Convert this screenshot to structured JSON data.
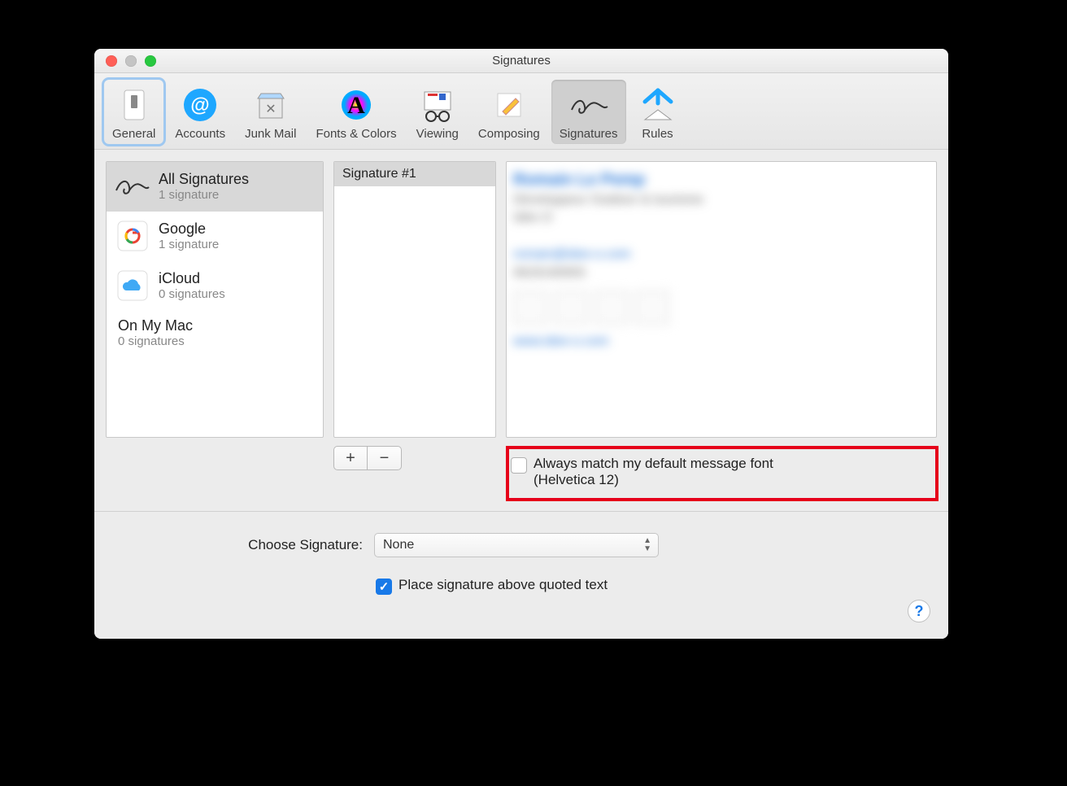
{
  "window": {
    "title": "Signatures"
  },
  "toolbar": {
    "items": [
      {
        "label": "General",
        "icon": "general-icon"
      },
      {
        "label": "Accounts",
        "icon": "accounts-icon"
      },
      {
        "label": "Junk Mail",
        "icon": "junk-icon"
      },
      {
        "label": "Fonts & Colors",
        "icon": "fonts-icon"
      },
      {
        "label": "Viewing",
        "icon": "viewing-icon"
      },
      {
        "label": "Composing",
        "icon": "composing-icon"
      },
      {
        "label": "Signatures",
        "icon": "signatures-icon"
      },
      {
        "label": "Rules",
        "icon": "rules-icon"
      }
    ]
  },
  "accounts": [
    {
      "name": "All Signatures",
      "sub": "1 signature",
      "icon": "signature-glyph-icon"
    },
    {
      "name": "Google",
      "sub": "1 signature",
      "icon": "google-icon"
    },
    {
      "name": "iCloud",
      "sub": "0 signatures",
      "icon": "icloud-icon"
    },
    {
      "name": "On My Mac",
      "sub": "0 signatures",
      "icon": null
    }
  ],
  "signatures": [
    "Signature #1"
  ],
  "match_font": {
    "label": "Always match my default message font",
    "sub": "(Helvetica 12)",
    "checked": false
  },
  "choose": {
    "label": "Choose Signature:",
    "value": "None"
  },
  "place_above": {
    "label": "Place signature above quoted text",
    "checked": true
  },
  "buttons": {
    "add": "+",
    "remove": "−"
  }
}
